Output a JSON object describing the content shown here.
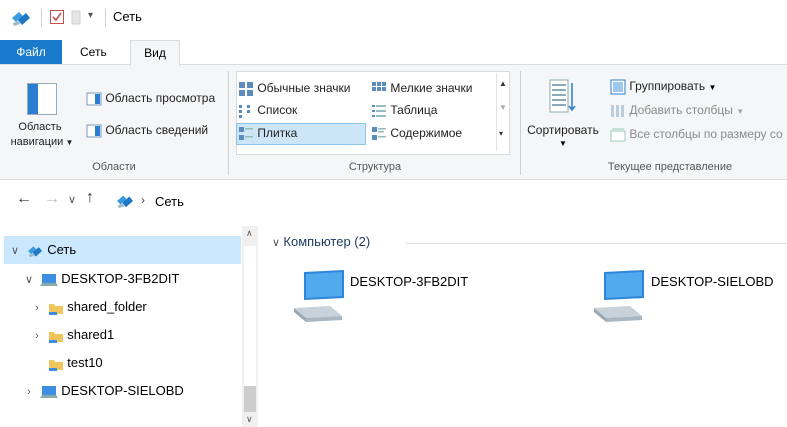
{
  "window": {
    "title": "Сеть"
  },
  "ribbon": {
    "tabs": [
      {
        "label": "Файл"
      },
      {
        "label": "Сеть"
      },
      {
        "label": "Вид"
      }
    ],
    "areas_group": {
      "label": "Области",
      "nav_pane_label_line1": "Область",
      "nav_pane_label_line2": "навигации",
      "preview_label": "Область просмотра",
      "details_label": "Область сведений"
    },
    "layout_group": {
      "label": "Структура",
      "items": [
        {
          "label": "Обычные значки"
        },
        {
          "label": "Мелкие значки"
        },
        {
          "label": "Список"
        },
        {
          "label": "Таблица"
        },
        {
          "label": "Плитка"
        },
        {
          "label": "Содержимое"
        }
      ],
      "selected": "Плитка"
    },
    "view_group": {
      "label": "Текущее представление",
      "sort_label": "Сортировать",
      "group_by_label": "Группировать",
      "add_columns_label": "Добавить столбцы",
      "size_columns_label": "Все столбцы по размеру со"
    }
  },
  "address": {
    "path": "Сеть"
  },
  "nav_pane": {
    "items": [
      {
        "label": "Сеть",
        "level": 0,
        "expanded": true,
        "selected": true
      },
      {
        "label": "DESKTOP-3FB2DIT",
        "level": 1,
        "expanded": true
      },
      {
        "label": "shared_folder",
        "level": 2,
        "expanded": false
      },
      {
        "label": "shared1",
        "level": 2,
        "expanded": false
      },
      {
        "label": "test10",
        "level": 2,
        "expanded": null
      },
      {
        "label": "DESKTOP-SIELOBD",
        "level": 1,
        "expanded": false
      }
    ]
  },
  "content": {
    "group_header": "Компьютер (2)",
    "items": [
      {
        "label": "DESKTOP-3FB2DIT"
      },
      {
        "label": "DESKTOP-SIELOBD"
      }
    ]
  },
  "colors": {
    "accent": "#1979ca",
    "selection": "#cce8ff",
    "selected_tile": "#cde6f7",
    "group_header": "#1e395b"
  }
}
